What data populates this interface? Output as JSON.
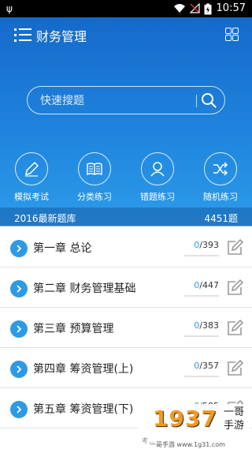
{
  "status_bar": {
    "usb_icon": "usb-icon",
    "time": "10:57",
    "icons": [
      "wifi-icon",
      "no-signal-icon",
      "battery-charging-icon"
    ]
  },
  "header": {
    "title": "财务管理",
    "menu_icon": "list-menu-icon",
    "grid_icon": "grid-icon"
  },
  "search": {
    "placeholder": "快速搜题",
    "icon": "search-icon"
  },
  "features": [
    {
      "label": "模拟考试",
      "icon": "pencil-icon"
    },
    {
      "label": "分类练习",
      "icon": "book-icon"
    },
    {
      "label": "错题练习",
      "icon": "user-icon"
    },
    {
      "label": "随机练习",
      "icon": "shuffle-icon"
    }
  ],
  "bank": {
    "name": "2016最新题库",
    "count": "4451题"
  },
  "chapters": [
    {
      "title": "第一章 总论",
      "done": "0",
      "total": "/393",
      "progress": 0
    },
    {
      "title": "第二章 财务管理基础",
      "done": "0",
      "total": "/447",
      "progress": 0
    },
    {
      "title": "第三章 预算管理",
      "done": "0",
      "total": "/383",
      "progress": 0
    },
    {
      "title": "第四章 筹资管理(上)",
      "done": "0",
      "total": "/357",
      "progress": 0
    },
    {
      "title": "第五章 筹资管理(下)",
      "done": "0",
      "total": "/505",
      "progress": 0
    }
  ],
  "watermark": {
    "number": "1937",
    "brand_top": "一哥",
    "brand_bottom": "手游",
    "site": "一哥手游 www.1g31.com",
    "hint": "考..."
  },
  "colors": {
    "primary": "#1e82dc",
    "accent": "#2e9ae6"
  }
}
